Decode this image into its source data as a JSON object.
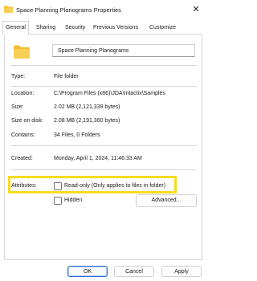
{
  "window": {
    "title": "Space Planning Planograms Properties",
    "close_symbol": "✕"
  },
  "tabs": [
    {
      "label": "General",
      "active": true
    },
    {
      "label": "Sharing",
      "active": false
    },
    {
      "label": "Security",
      "active": false
    },
    {
      "label": "Previous Versions",
      "active": false
    },
    {
      "label": "Customize",
      "active": false
    }
  ],
  "general": {
    "folder_name": "Space Planning Planograms",
    "type_label": "Type:",
    "type_value": "File folder",
    "location_label": "Location:",
    "location_value": "C:\\Program Files (x86)\\JDA\\Intactix\\Samples",
    "size_label": "Size:",
    "size_value": "2.02 MB (2,121,339 bytes)",
    "size_on_disk_label": "Size on disk:",
    "size_on_disk_value": "2.08 MB (2,191,360 bytes)",
    "contains_label": "Contains:",
    "contains_value": "34 Files, 0 Folders",
    "created_label": "Created:",
    "created_value": "Monday, April 1, 2024, 11:46:33 AM",
    "attributes_label": "Attributes:",
    "readonly_label": "Read-only (Only applies to files in folder)",
    "readonly_checked": false,
    "hidden_label": "Hidden",
    "hidden_checked": false,
    "advanced_label": "Advanced..."
  },
  "footer": {
    "ok_label": "OK",
    "cancel_label": "Cancel",
    "apply_label": "Apply"
  },
  "colors": {
    "highlight": "#f6dc1e",
    "folder": "#f2bf3a",
    "primary_border": "#2f6fcf"
  },
  "icons": {
    "title_icon": "folder-icon",
    "big_icon": "folder-icon",
    "close_icon": "close-icon"
  }
}
